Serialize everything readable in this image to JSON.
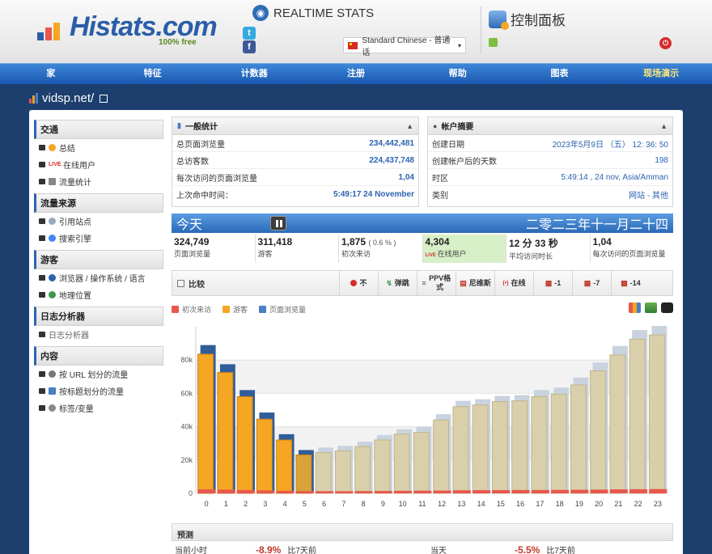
{
  "header": {
    "logo_text": "Histats.com",
    "logo_free": "100% free",
    "realtime_label": "REALTIME STATS",
    "language": "Standard Chinese - 普通话",
    "control_panel": "控制面板"
  },
  "nav": [
    "家",
    "特征",
    "计数器",
    "注册",
    "帮助",
    "图表",
    "现场演示"
  ],
  "site": {
    "name": "vidsp.net/"
  },
  "sidebar": [
    {
      "title": "交通",
      "items": [
        "总结",
        "在线用户",
        "流量统计"
      ]
    },
    {
      "title": "流量来源",
      "items": [
        "引用站点",
        "搜索引擎"
      ]
    },
    {
      "title": "游客",
      "items": [
        "浏览器 / 操作系统 / 语言",
        "地理位置"
      ]
    },
    {
      "title": "日志分析器",
      "items": [
        "日志分析器"
      ]
    },
    {
      "title": "内容",
      "items": [
        "按 URL 划分的流量",
        "按标题划分的流量",
        "标签/变量"
      ]
    }
  ],
  "general": {
    "title": "一般统计",
    "rows": [
      {
        "label": "总页面浏览量",
        "value": "234,442,481"
      },
      {
        "label": "总访客数",
        "value": "224,437,748"
      },
      {
        "label": "每次访问的页面浏览量",
        "value": "1,04"
      },
      {
        "label": "上次命中时间：",
        "value": "5:49:17 24 November"
      }
    ]
  },
  "account": {
    "title": "帐户摘要",
    "rows": [
      {
        "label": "创建日期",
        "value": "2023年5月9日 （五） 12: 36: 50"
      },
      {
        "label": "创建帐户后的天数",
        "value": "198"
      },
      {
        "label": "时区",
        "value": "5:49:14 , 24 nov, Asia/Amman"
      },
      {
        "label": "类别",
        "value": "网站 - 其他"
      }
    ]
  },
  "today": {
    "label": "今天",
    "date": "二零二三年十一月二十四"
  },
  "kpis": [
    {
      "value": "324,749",
      "label": "页面浏览量"
    },
    {
      "value": "311,418",
      "label": "游客"
    },
    {
      "value": "1,875",
      "pct": "( 0.6 % )",
      "label": "初次来访"
    },
    {
      "value": "4,304",
      "label": "在线用户"
    },
    {
      "value": "12 分 33 秒",
      "label": "平均访问时长"
    },
    {
      "value": "1,04",
      "label": "每次访问的页面浏览量"
    }
  ],
  "toolbar": {
    "compare": "比较",
    "buttons": [
      "不",
      "弹跳",
      "PPV格式",
      "尼维斯",
      "在线",
      "-1",
      "-7",
      "-14"
    ]
  },
  "legend": [
    "初次来访",
    "游客",
    "页面浏览量"
  ],
  "colors": {
    "first": "#e8584e",
    "visitors": "#f5a623",
    "pageviews": "#4a7fc1",
    "nav": "#1a58b0"
  },
  "chart_data": {
    "type": "bar",
    "categories": [
      "0",
      "1",
      "2",
      "3",
      "4",
      "5",
      "6",
      "7",
      "8",
      "9",
      "10",
      "11",
      "12",
      "13",
      "14",
      "15",
      "16",
      "17",
      "18",
      "19",
      "20",
      "21",
      "22",
      "23"
    ],
    "series": [
      {
        "name": "初次来访",
        "values": [
          300,
          280,
          250,
          220,
          190,
          170,
          160,
          160,
          170,
          180,
          190,
          200,
          210,
          230,
          240,
          240,
          250,
          250,
          260,
          270,
          280,
          300,
          310,
          320
        ]
      },
      {
        "name": "游客",
        "values": [
          85000,
          74000,
          59500,
          46000,
          33500,
          24500,
          26000,
          27000,
          29500,
          33500,
          37000,
          38000,
          45500,
          53500,
          54500,
          56500,
          57000,
          59500,
          61000,
          66500,
          75000,
          84500,
          94000,
          96500
        ]
      },
      {
        "name": "页面浏览量",
        "values": [
          89000,
          77500,
          62000,
          48500,
          35500,
          26000,
          27500,
          28500,
          31000,
          35000,
          38500,
          40000,
          47500,
          55500,
          56500,
          58500,
          59000,
          62000,
          63500,
          69500,
          78500,
          88500,
          98000,
          100500
        ]
      }
    ],
    "current_hour": 5,
    "ylim": [
      0,
      100000
    ],
    "yticks": [
      "0",
      "20k",
      "40k",
      "60k",
      "80k"
    ],
    "grid": true
  },
  "forecast": {
    "title": "预测",
    "left": {
      "label": "当前小时",
      "value": "-8.9%",
      "note": "比7天前"
    },
    "right": {
      "label": "当天",
      "value": "-5.5%",
      "note": "比7天前"
    }
  }
}
